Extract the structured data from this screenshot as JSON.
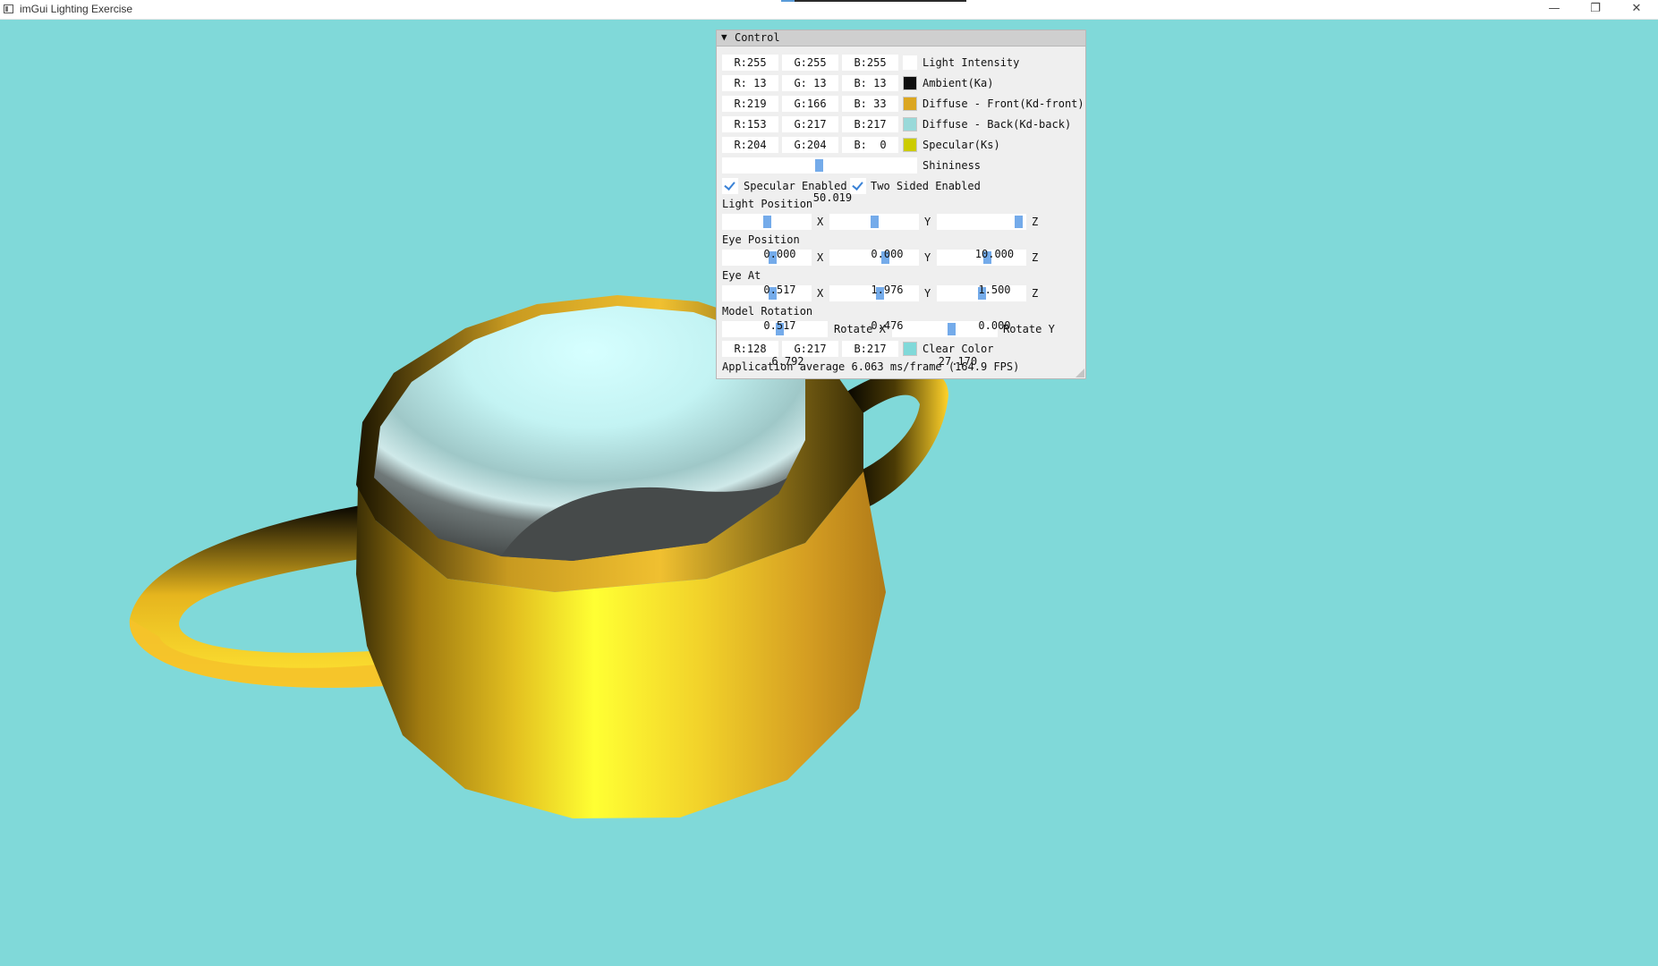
{
  "window": {
    "title": "imGui Lighting Exercise",
    "controls": {
      "minimize": "—",
      "restore": "❐",
      "close": "✕"
    }
  },
  "scene": {
    "clear_color": "#80d9d9",
    "object": "teapot"
  },
  "panel": {
    "title": "Control",
    "colors": [
      {
        "r": "R:255",
        "g": "G:255",
        "b": "B:255",
        "swatch": "#ffffff",
        "label": "Light Intensity"
      },
      {
        "r": "R: 13",
        "g": "G: 13",
        "b": "B: 13",
        "swatch": "#0d0d0d",
        "label": "Ambient(Ka)"
      },
      {
        "r": "R:219",
        "g": "G:166",
        "b": "B: 33",
        "swatch": "#dba621",
        "label": "Diffuse - Front(Kd-front)"
      },
      {
        "r": "R:153",
        "g": "G:217",
        "b": "B:217",
        "swatch": "#99d9d9",
        "label": "Diffuse - Back(Kd-back)"
      },
      {
        "r": "R:204",
        "g": "G:204",
        "b": "B:  0",
        "swatch": "#cccc00",
        "label": "Specular(Ks)"
      }
    ],
    "shininess": {
      "value": "50.019",
      "label": "Shininess"
    },
    "specular_enabled": {
      "checked": true,
      "label": "Specular Enabled"
    },
    "two_sided_enabled": {
      "checked": true,
      "label": "Two Sided Enabled"
    },
    "light_position": {
      "label": "Light Position",
      "x": "0.000",
      "y": "0.000",
      "z": "10.000",
      "x_label": "X",
      "y_label": "Y",
      "z_label": "Z"
    },
    "eye_position": {
      "label": "Eye Position",
      "x": "0.517",
      "y": "1.976",
      "z": "1.500",
      "x_label": "X",
      "y_label": "Y",
      "z_label": "Z"
    },
    "eye_at": {
      "label": "Eye At",
      "x": "0.517",
      "y": "0.476",
      "z": "0.000",
      "x_label": "X",
      "y_label": "Y",
      "z_label": "Z"
    },
    "model_rotation": {
      "label": "Model Rotation",
      "rot_x": "6.792",
      "rot_x_label": "Rotate X",
      "rot_y": "27.170",
      "rot_y_label": "Rotate Y"
    },
    "clear_color": {
      "r": "R:128",
      "g": "G:217",
      "b": "B:217",
      "swatch": "#80d9d9",
      "label": "Clear Color"
    },
    "status": "Application average 6.063 ms/frame (164.9 FPS)"
  }
}
